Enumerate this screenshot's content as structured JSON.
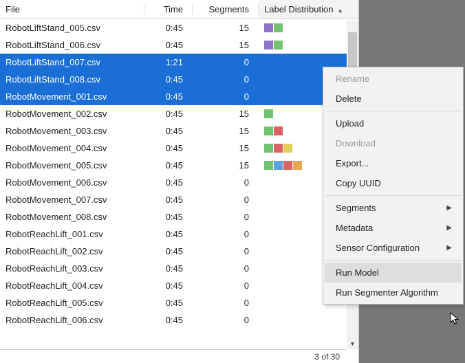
{
  "columns": {
    "file": "File",
    "time": "Time",
    "segments": "Segments",
    "label_dist": "Label Distribution"
  },
  "colors": {
    "purple": "#8e73c7",
    "green": "#72c272",
    "red": "#d96262",
    "yellow": "#e6cf5b",
    "orange": "#e8a552",
    "blue": "#5aa0e0"
  },
  "rows": [
    {
      "file": "RobotLiftStand_005.csv",
      "time": "0:45",
      "segments": "15",
      "swatches": [
        "purple",
        "green"
      ]
    },
    {
      "file": "RobotLiftStand_006.csv",
      "time": "0:45",
      "segments": "15",
      "swatches": [
        "purple",
        "green"
      ]
    },
    {
      "file": "RobotLiftStand_007.csv",
      "time": "1:21",
      "segments": "0",
      "swatches": [],
      "selected": true
    },
    {
      "file": "RobotLiftStand_008.csv",
      "time": "0:45",
      "segments": "0",
      "swatches": [],
      "selected": true
    },
    {
      "file": "RobotMovement_001.csv",
      "time": "0:45",
      "segments": "0",
      "swatches": [],
      "selected": true
    },
    {
      "file": "RobotMovement_002.csv",
      "time": "0:45",
      "segments": "15",
      "swatches": [
        "green"
      ]
    },
    {
      "file": "RobotMovement_003.csv",
      "time": "0:45",
      "segments": "15",
      "swatches": [
        "green",
        "red"
      ]
    },
    {
      "file": "RobotMovement_004.csv",
      "time": "0:45",
      "segments": "15",
      "swatches": [
        "green",
        "red",
        "yellow"
      ]
    },
    {
      "file": "RobotMovement_005.csv",
      "time": "0:45",
      "segments": "15",
      "swatches": [
        "green",
        "blue",
        "red",
        "orange"
      ]
    },
    {
      "file": "RobotMovement_006.csv",
      "time": "0:45",
      "segments": "0",
      "swatches": []
    },
    {
      "file": "RobotMovement_007.csv",
      "time": "0:45",
      "segments": "0",
      "swatches": []
    },
    {
      "file": "RobotMovement_008.csv",
      "time": "0:45",
      "segments": "0",
      "swatches": []
    },
    {
      "file": "RobotReachLift_001.csv",
      "time": "0:45",
      "segments": "0",
      "swatches": []
    },
    {
      "file": "RobotReachLift_002.csv",
      "time": "0:45",
      "segments": "0",
      "swatches": []
    },
    {
      "file": "RobotReachLift_003.csv",
      "time": "0:45",
      "segments": "0",
      "swatches": []
    },
    {
      "file": "RobotReachLift_004.csv",
      "time": "0:45",
      "segments": "0",
      "swatches": []
    },
    {
      "file": "RobotReachLift_005.csv",
      "time": "0:45",
      "segments": "0",
      "swatches": []
    },
    {
      "file": "RobotReachLift_006.csv",
      "time": "0:45",
      "segments": "0",
      "swatches": []
    }
  ],
  "footer": {
    "count_text": "3 of 30"
  },
  "menu": {
    "rename": "Rename",
    "delete": "Delete",
    "upload": "Upload",
    "download": "Download",
    "exportx": "Export...",
    "copy_uuid": "Copy UUID",
    "segments": "Segments",
    "metadata": "Metadata",
    "sensor_config": "Sensor Configuration",
    "run_model": "Run Model",
    "run_segmenter": "Run Segmenter Algorithm"
  }
}
